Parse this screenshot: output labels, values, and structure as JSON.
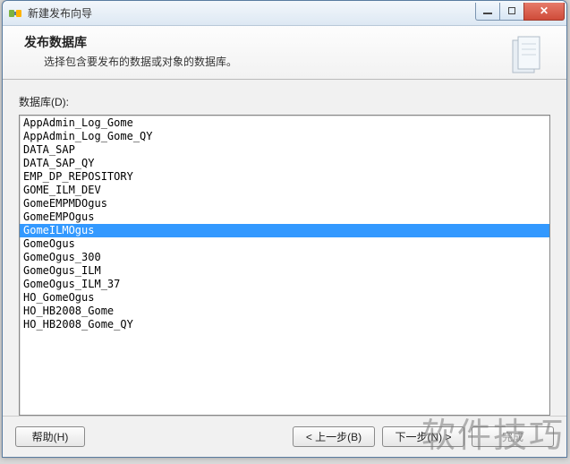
{
  "window": {
    "title": "新建发布向导"
  },
  "header": {
    "title": "发布数据库",
    "subtitle": "选择包含要发布的数据或对象的数据库。"
  },
  "content": {
    "list_label": "数据库(D):",
    "databases": [
      "AppAdmin_Log_Gome",
      "AppAdmin_Log_Gome_QY",
      "DATA_SAP",
      "DATA_SAP_QY",
      "EMP_DP_REPOSITORY",
      "GOME_ILM_DEV",
      "GomeEMPMDOgus",
      "GomeEMPOgus",
      "GomeILMOgus",
      "GomeOgus",
      "GomeOgus_300",
      "GomeOgus_ILM",
      "GomeOgus_ILM_37",
      "HO_GomeOgus",
      "HO_HB2008_Gome",
      "HO_HB2008_Gome_QY"
    ],
    "selected_index": 8
  },
  "buttons": {
    "help": "帮助(H)",
    "back": "< 上一步(B)",
    "next": "下一步(N) >",
    "finish": "完成"
  },
  "watermark": "软件技巧"
}
